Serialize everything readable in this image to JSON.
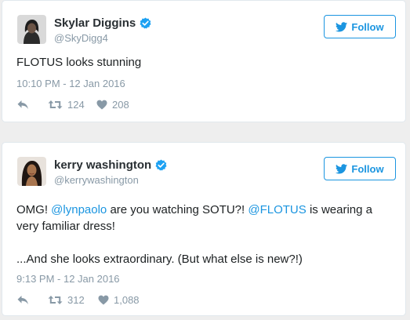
{
  "colors": {
    "accent": "#1b95e0",
    "muted": "#8899a6",
    "verified": "#1da1f2"
  },
  "tweets": [
    {
      "name": "Skylar Diggins",
      "handle": "@SkyDigg4",
      "follow_label": "Follow",
      "text": "FLOTUS looks stunning",
      "timestamp": "10:10 PM - 12 Jan 2016",
      "retweets": "124",
      "likes": "208",
      "icons": [
        "reply-icon",
        "retweet-icon",
        "heart-icon"
      ]
    },
    {
      "name": "kerry washington",
      "handle": "@kerrywashington",
      "follow_label": "Follow",
      "text_parts": [
        "OMG! ",
        "@lynpaolo",
        " are you watching SOTU?! ",
        "@FLOTUS",
        " is wearing a very familiar dress!"
      ],
      "text_line2": "...And she looks extraordinary. (But what else is new?!)",
      "timestamp": "9:13 PM - 12 Jan 2016",
      "retweets": "312",
      "likes": "1,088",
      "icons": [
        "reply-icon",
        "retweet-icon",
        "heart-icon"
      ]
    }
  ]
}
